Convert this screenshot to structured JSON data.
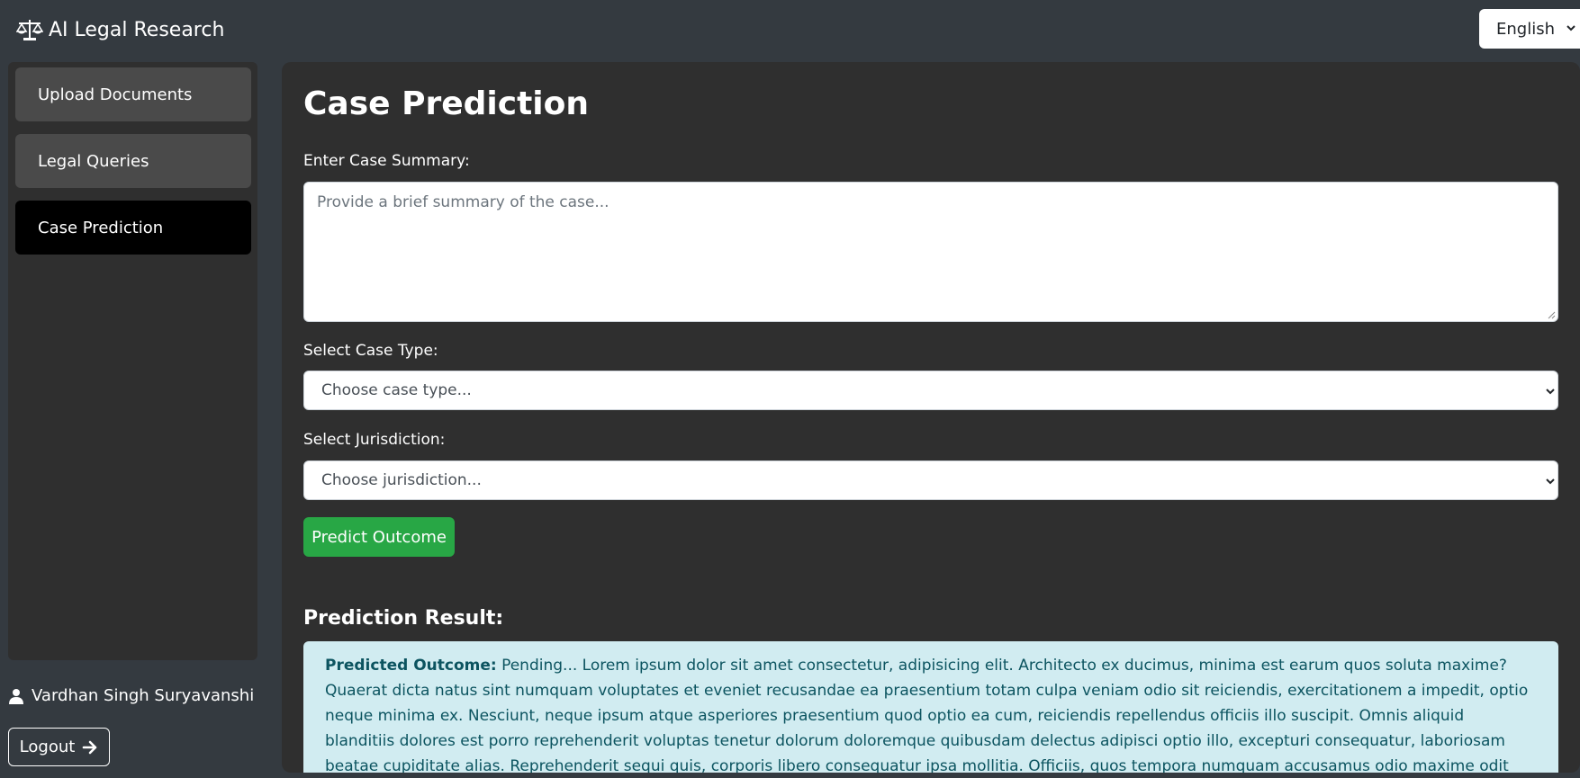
{
  "app": {
    "title": "AI Legal Research",
    "logo_icon": "balance-scale-icon"
  },
  "language": {
    "selected": "English"
  },
  "sidebar": {
    "items": [
      {
        "label": "Upload Documents",
        "active": false
      },
      {
        "label": "Legal Queries",
        "active": false
      },
      {
        "label": "Case Prediction",
        "active": true
      }
    ],
    "user_name": "Vardhan Singh Suryavanshi",
    "logout_label": "Logout"
  },
  "main": {
    "title": "Case Prediction",
    "summary_label": "Enter Case Summary:",
    "summary_placeholder": "Provide a brief summary of the case...",
    "case_type_label": "Select Case Type:",
    "case_type_value": "Choose case type...",
    "jurisdiction_label": "Select Jurisdiction:",
    "jurisdiction_value": "Choose jurisdiction...",
    "predict_button": "Predict Outcome",
    "result_heading": "Prediction Result:",
    "result_label": "Predicted Outcome:",
    "result_text": " Pending... Lorem ipsum dolor sit amet consectetur, adipisicing elit. Architecto ex ducimus, minima est earum quos soluta maxime? Quaerat dicta natus sint numquam voluptates et eveniet recusandae ea praesentium totam culpa veniam odio sit reiciendis, exercitationem a impedit, optio neque minima ex. Nesciunt, neque ipsum atque asperiores praesentium quod optio ea cum, reiciendis repellendus officiis illo suscipit. Omnis aliquid blanditiis dolores est porro reprehenderit voluptas tenetur dolorum doloremque quibusdam delectus adipisci optio illo, excepturi consequatur, laboriosam beatae cupiditate alias. Reprehenderit sequi quis, corporis libero consequatur ipsa mollitia. Officiis, quos tempora numquam accusamus odio maxime odit itaque, aliquam architecto"
  },
  "colors": {
    "background": "#343a40",
    "panel": "#2f2f2f",
    "nav_item": "#4a4a4a",
    "nav_active": "#000000",
    "predict_button": "#28a745",
    "result_bg": "#d1ecf1",
    "result_text": "#0c5460"
  }
}
